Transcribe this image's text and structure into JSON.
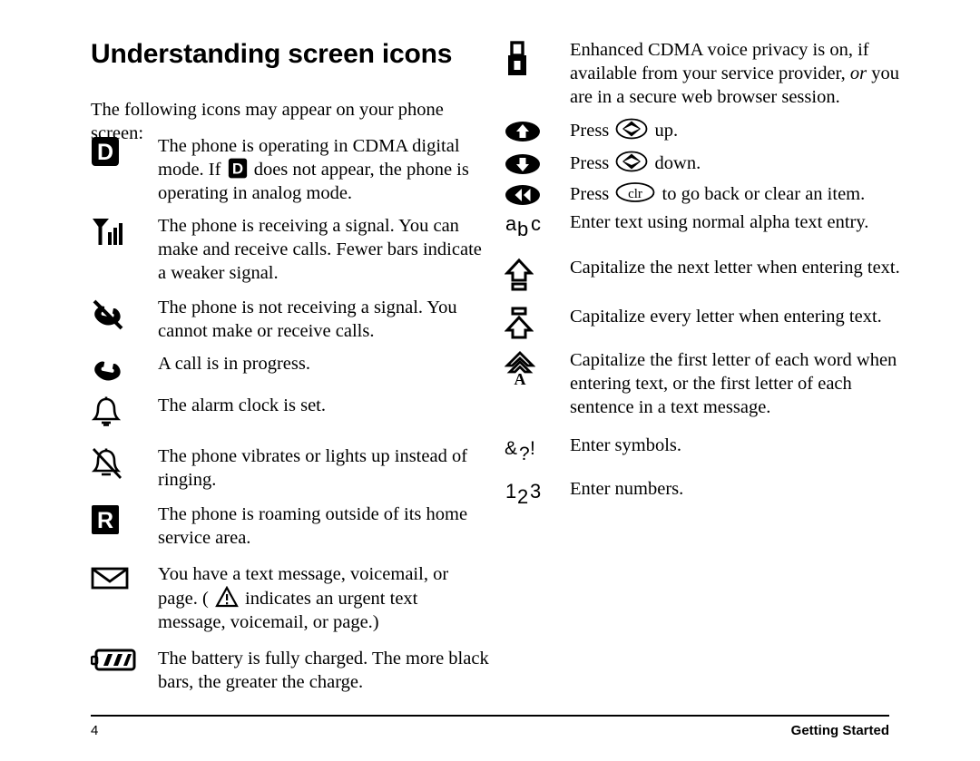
{
  "page": {
    "title": "Understanding screen icons",
    "intro": "The following icons may appear on your phone screen:",
    "folio": "4",
    "running_head": "Getting Started"
  },
  "colors": {
    "ink": "#000000",
    "paper": "#ffffff"
  },
  "left_column": [
    {
      "icon": "cdma-digital-mode-icon",
      "icon_label": "D",
      "text_parts": [
        {
          "type": "text",
          "value": "The phone is operating in CDMA digital mode. If "
        },
        {
          "type": "icon",
          "value": "cdma-digital-mode-icon"
        },
        {
          "type": "text",
          "value": " does not appear, the phone is operating in analog mode."
        }
      ],
      "text": "The phone is operating in CDMA digital mode. If D does not appear, the phone is operating in analog mode."
    },
    {
      "icon": "signal-strength-icon",
      "text": "The phone is receiving a signal. You can make and receive calls. Fewer bars indicate a weaker signal."
    },
    {
      "icon": "no-signal-icon",
      "text": "The phone is not receiving a signal. You cannot make or receive calls."
    },
    {
      "icon": "call-in-progress-icon",
      "text": "A call is in progress."
    },
    {
      "icon": "alarm-clock-icon",
      "text": "The alarm clock is set."
    },
    {
      "icon": "vibrate-icon",
      "text": "The phone vibrates or lights up instead of ringing."
    },
    {
      "icon": "roaming-icon",
      "icon_label": "R",
      "text": "The phone is roaming outside of its home service area."
    },
    {
      "icon": "message-envelope-icon",
      "text_parts": [
        {
          "type": "text",
          "value": "You have a text message, voicemail, or page. ( "
        },
        {
          "type": "icon",
          "value": "urgent-warning-icon"
        },
        {
          "type": "text",
          "value": " indicates an urgent text message, voicemail, or page.)"
        }
      ],
      "text": "You have a text message, voicemail, or page. ( ! indicates an urgent text message, voicemail, or page.)"
    },
    {
      "icon": "battery-full-icon",
      "text": "The battery is fully charged. The more black bars, the greater the charge."
    }
  ],
  "right_column": [
    {
      "icon": "secure-lock-icon",
      "text_parts": [
        {
          "type": "text",
          "value": "Enhanced CDMA voice privacy is on, if available from your service provider, "
        },
        {
          "type": "italic",
          "value": "or"
        },
        {
          "type": "text",
          "value": " you are in a secure web browser session."
        }
      ],
      "text": "Enhanced CDMA voice privacy is on, if available from your service provider, or you are in a secure web browser session."
    },
    {
      "icon": "nav-up-icon",
      "text_parts": [
        {
          "type": "text",
          "value": "Press "
        },
        {
          "type": "icon",
          "value": "nav-key-icon"
        },
        {
          "type": "text",
          "value": " up."
        }
      ],
      "text": "Press (nav key) up."
    },
    {
      "icon": "nav-down-icon",
      "text_parts": [
        {
          "type": "text",
          "value": "Press "
        },
        {
          "type": "icon",
          "value": "nav-key-icon"
        },
        {
          "type": "text",
          "value": " down."
        }
      ],
      "text": "Press (nav key) down."
    },
    {
      "icon": "nav-back-icon",
      "text_parts": [
        {
          "type": "text",
          "value": "Press "
        },
        {
          "type": "icon",
          "value": "clr-key-icon",
          "label": "clr"
        },
        {
          "type": "text",
          "value": " to go back or clear an item."
        }
      ],
      "text": "Press clr to go back or clear an item."
    },
    {
      "icon": "alpha-text-entry-icon",
      "icon_label": "abc",
      "text": "Enter text using normal alpha text entry."
    },
    {
      "icon": "shift-next-letter-icon",
      "text": "Capitalize the next letter when entering text."
    },
    {
      "icon": "caps-lock-icon",
      "text": "Capitalize every letter when entering text."
    },
    {
      "icon": "word-caps-icon",
      "icon_label": "A",
      "text": "Capitalize the first letter of each word when entering text, or the first letter of each sentence in a text message."
    },
    {
      "icon": "symbols-entry-icon",
      "icon_label": "&?!",
      "text": "Enter symbols."
    },
    {
      "icon": "numbers-entry-icon",
      "icon_label": "123",
      "text": "Enter numbers."
    }
  ]
}
